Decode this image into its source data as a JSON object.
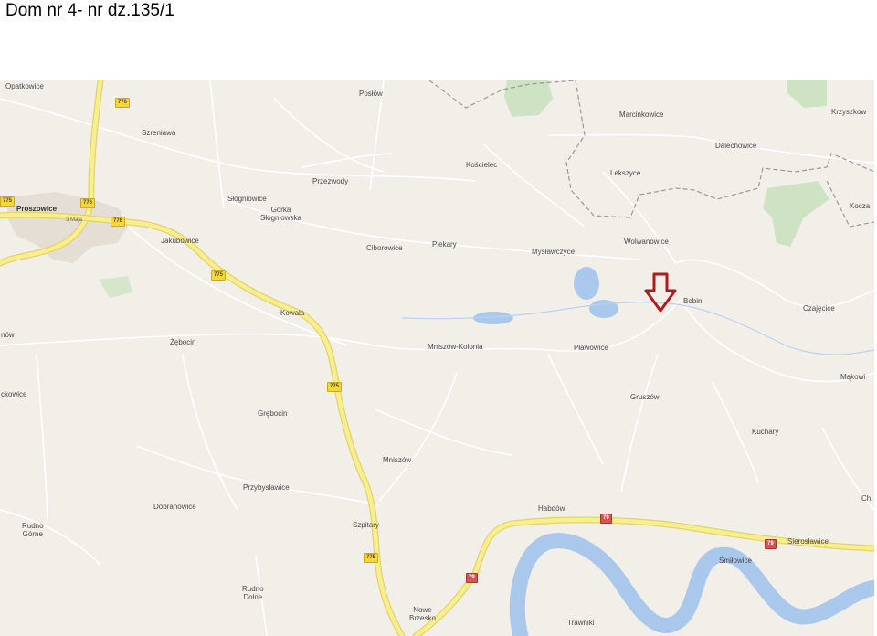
{
  "title": "Dom nr 4- nr dz.135/1",
  "colors": {
    "land": "#f2efe9",
    "water": "#a9c8ec",
    "forest": "#cde3c4",
    "major_road": "#f7ef8c",
    "road_border": "#e3d26e",
    "minor_road": "#ffffff",
    "border": "#8a8a8a",
    "marker": "#b0191e"
  },
  "marker": {
    "icon": "arrow-down-icon"
  },
  "places": [
    {
      "id": "opatkowice",
      "label": "Opatkowice"
    },
    {
      "id": "poslow",
      "label": "Posłów"
    },
    {
      "id": "marcinkowice",
      "label": "Marcinkowice"
    },
    {
      "id": "krzyszkow",
      "label": "Krzyszkow"
    },
    {
      "id": "szreniawa",
      "label": "Szreniawa"
    },
    {
      "id": "koscielec",
      "label": "Kościelec"
    },
    {
      "id": "dalechowice",
      "label": "Dalechowice"
    },
    {
      "id": "przezwody",
      "label": "Przezwody"
    },
    {
      "id": "lekszyce",
      "label": "Lekszyce"
    },
    {
      "id": "proszowice",
      "label": "Proszowice"
    },
    {
      "id": "slogniowice",
      "label": "Słogniowice"
    },
    {
      "id": "gorka-slogniowska",
      "label": "Górka\nSłogniowska"
    },
    {
      "id": "kocza",
      "label": "Kocza"
    },
    {
      "id": "jakubowice",
      "label": "Jakubowice"
    },
    {
      "id": "ciborowice",
      "label": "Ciborowice"
    },
    {
      "id": "piekary",
      "label": "Piekary"
    },
    {
      "id": "myslawczyce",
      "label": "Mysławczyce"
    },
    {
      "id": "wolwanowice",
      "label": "Wolwanowice"
    },
    {
      "id": "bobin",
      "label": "Bobin"
    },
    {
      "id": "czajecice",
      "label": "Czajęcice"
    },
    {
      "id": "kowala",
      "label": "Kowala"
    },
    {
      "id": "zeboce",
      "label": "Żębocin"
    },
    {
      "id": "mniszow-kolonia",
      "label": "Mniszów-Kolonia"
    },
    {
      "id": "plawowice",
      "label": "Pławowice"
    },
    {
      "id": "makowice",
      "label": "Mąkowi"
    },
    {
      "id": "left-1",
      "label": "nów"
    },
    {
      "id": "left-2",
      "label": "ckowice"
    },
    {
      "id": "gruszow",
      "label": "Gruszów"
    },
    {
      "id": "grebocin",
      "label": "Grębocin"
    },
    {
      "id": "kuchary",
      "label": "Kuchary"
    },
    {
      "id": "mniszow",
      "label": "Mniszów"
    },
    {
      "id": "przybyslawice",
      "label": "Przybysławice"
    },
    {
      "id": "dobranowice",
      "label": "Dobranowice"
    },
    {
      "id": "habdow",
      "label": "Habdów"
    },
    {
      "id": "ch",
      "label": "Ch"
    },
    {
      "id": "rudno-gorne",
      "label": "Rudno\nGórne"
    },
    {
      "id": "szpitary",
      "label": "Szpitary"
    },
    {
      "id": "sieroslawice",
      "label": "Sierosławice"
    },
    {
      "id": "smilowice",
      "label": "Śmiłowice"
    },
    {
      "id": "rudno-dolne",
      "label": "Rudno\nDolne"
    },
    {
      "id": "nowe-brzesko",
      "label": "Nowe\nBrzesko"
    },
    {
      "id": "trawniki",
      "label": "Trawniki"
    },
    {
      "id": "3-maja",
      "label": "3 Maja"
    }
  ],
  "shields": [
    {
      "id": "s776-top",
      "label": "776"
    },
    {
      "id": "s776-a",
      "label": "776"
    },
    {
      "id": "s776-b",
      "label": "776"
    },
    {
      "id": "s775-a",
      "label": "775"
    },
    {
      "id": "s775-b",
      "label": "775"
    },
    {
      "id": "s775-c",
      "label": "775"
    },
    {
      "id": "s79-a",
      "label": "79"
    },
    {
      "id": "s79-b",
      "label": "79"
    },
    {
      "id": "s79-c",
      "label": "79"
    },
    {
      "id": "s-left",
      "label": "775"
    }
  ]
}
